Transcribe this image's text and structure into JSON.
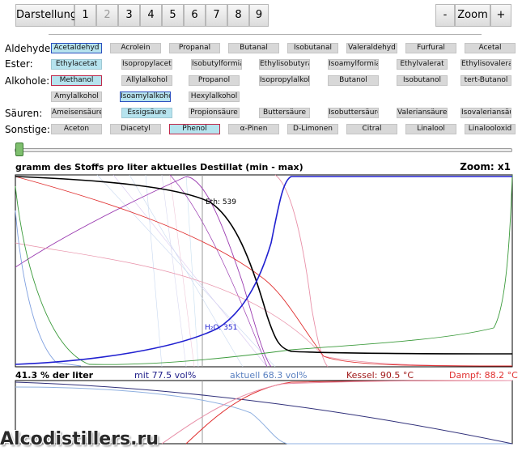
{
  "toolbar": {
    "display_label": "Darstellung",
    "pages": [
      "1",
      "2",
      "3",
      "4",
      "5",
      "6",
      "7",
      "8",
      "9"
    ],
    "zoom_minus": "-",
    "zoom_label": "Zoom",
    "zoom_plus": "+"
  },
  "categories": {
    "aldehyde": {
      "label": "Aldehyde:",
      "items": [
        "Acetaldehyd",
        "Acrolein",
        "Propanal",
        "Butanal",
        "Isobutanal",
        "Valeraldehyd",
        "Furfural",
        "Acetal"
      ]
    },
    "ester": {
      "label": "Ester:",
      "items": [
        "Ethylacetat",
        "Isopropylacetat",
        "Isobutylformiat",
        "Ethylisobutyrat",
        "Isoamylformiat",
        "Ethylvalerat",
        "Ethylisovalerat"
      ]
    },
    "alkohole": {
      "label": "Alkohole:",
      "items": [
        "Methanol",
        "Allylalkohol",
        "Propanol",
        "Isopropylalkohol",
        "Butanol",
        "Isobutanol",
        "tert-Butanol"
      ],
      "items2": [
        "Amylalkohol",
        "Isoamylalkohol",
        "Hexylalkohol"
      ]
    },
    "saeuren": {
      "label": "Säuren:",
      "items": [
        "Ameisensäure",
        "Essigsäure",
        "Propionsäure",
        "Buttersäure",
        "Isobuttersäure",
        "Valeriansäure",
        "Isovaleriansäure"
      ]
    },
    "sonstige": {
      "label": "Sonstige:",
      "items": [
        "Aceton",
        "Diacetyl",
        "Phenol",
        "α-Pinen",
        "D-Limonen",
        "Citral",
        "Linalool",
        "Linalooloxid"
      ]
    }
  },
  "chart": {
    "title": "gramm des Stoffs pro liter aktuelles Destillat (min - max)",
    "zoom": "Zoom: x1",
    "label_eth": "Eth: 539",
    "label_h2o": "H₂O: 351"
  },
  "stats": {
    "percent_liter": "41.3 % der liter",
    "mit": "mit 77.5 vol%",
    "aktuell": "aktuell 68.3 vol%",
    "kessel": "Kessel: 90.5 °C",
    "dampf": "Dampf: 88.2 °C"
  },
  "watermark": "Alcodistillers.ru",
  "colors": {
    "ethanol": "#000000",
    "water": "#2020d0",
    "methanol": "#e03030",
    "green": "#3a9a3a",
    "purple": "#9a3ab0",
    "pink": "#e890a8",
    "lightblue": "#8fb0e0",
    "selected_chip": "#b6e3ee"
  }
}
